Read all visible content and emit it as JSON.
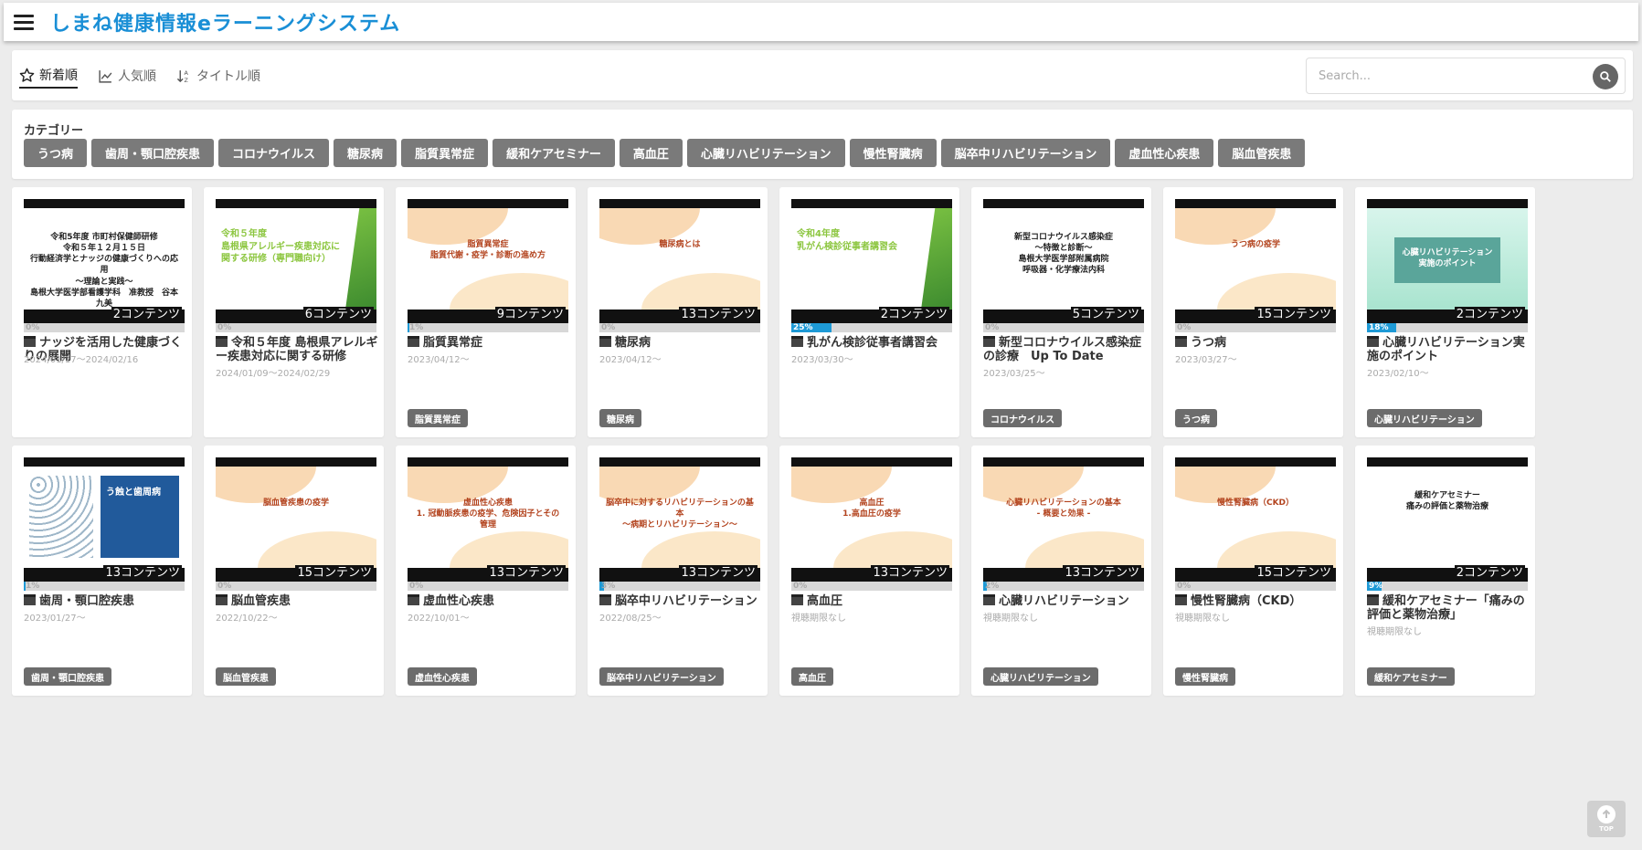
{
  "header": {
    "title": "しまね健康情報eラーニングシステム",
    "menu_icon": "hamburger-icon"
  },
  "sort": {
    "tabs": [
      {
        "label": "新着順",
        "icon": "star-icon",
        "active": true
      },
      {
        "label": "人気順",
        "icon": "trend-icon",
        "active": false
      },
      {
        "label": "タイトル順",
        "icon": "sort-az-icon",
        "active": false
      }
    ]
  },
  "search": {
    "placeholder": "Search...",
    "icon": "search-icon"
  },
  "categories": {
    "heading": "カテゴリー",
    "items": [
      "うつ病",
      "歯周・顎口腔疾患",
      "コロナウイルス",
      "糖尿病",
      "脂質異常症",
      "緩和ケアセミナー",
      "高血圧",
      "心臓リハビリテーション",
      "慢性腎臓病",
      "脳卒中リハビリテーション",
      "虚血性心疾患",
      "脳血管疾患"
    ]
  },
  "courses": [
    {
      "title": "ナッジを活用した健康づくりの展開",
      "date": "2024/01/17～2024/02/16",
      "count": "2コンテンツ",
      "progress": 0,
      "progress_label": "0%",
      "tag": "",
      "slide_style": "white",
      "slide_text": "令和5年度 市町村保健師研修\n令和５年１２月１５日\n行動経済学とナッジの健康づくりへの応用\n～理論と実践～\n島根大学医学部看護学科　准教授　谷本 九美"
    },
    {
      "title": "令和５年度 島根県アレルギー疾患対応に関する研修",
      "date": "2024/01/09～2024/02/29",
      "count": "6コンテンツ",
      "progress": 0,
      "progress_label": "0%",
      "tag": "",
      "slide_style": "green",
      "slide_text": "令和５年度\n島根県アレルギー疾患対応に\n関する研修（専門職向け）"
    },
    {
      "title": "脂質異常症",
      "date": "2023/04/12～",
      "count": "9コンテンツ",
      "progress": 1,
      "progress_label": "1%",
      "tag": "脂質異常症",
      "slide_style": "peach",
      "slide_text": "脂質異常症\n脂質代謝・疫学・診断の進め方"
    },
    {
      "title": "糖尿病",
      "date": "2023/04/12～",
      "count": "13コンテンツ",
      "progress": 0,
      "progress_label": "0%",
      "tag": "糖尿病",
      "slide_style": "peach",
      "slide_text": "糖尿病とは"
    },
    {
      "title": "乳がん検診従事者講習会",
      "date": "2023/03/30～",
      "count": "2コンテンツ",
      "progress": 25,
      "progress_label": "25%",
      "tag": "",
      "slide_style": "green",
      "slide_text": "令和4年度\n乳がん検診従事者講習会"
    },
    {
      "title": "新型コロナウイルス感染症の診療　Up To Date",
      "date": "2023/03/25～",
      "count": "5コンテンツ",
      "progress": 0,
      "progress_label": "0%",
      "tag": "コロナウイルス",
      "slide_style": "white",
      "slide_text": "新型コロナウイルス感染症\n～特徴と診断～\n島根大学医学部附属病院\n呼吸器・化学療法内科"
    },
    {
      "title": "うつ病",
      "date": "2023/03/27～",
      "count": "15コンテンツ",
      "progress": 0,
      "progress_label": "0%",
      "tag": "うつ病",
      "slide_style": "peach",
      "slide_text": "うつ病の疫学"
    },
    {
      "title": "心臓リハビリテーション実施のポイント",
      "date": "2023/02/10～",
      "count": "2コンテンツ",
      "progress": 18,
      "progress_label": "18%",
      "tag": "心臓リハビリテーション",
      "slide_style": "teal",
      "slide_text": "心臓リハビリテーション\n実施のポイント"
    },
    {
      "title": "歯周・顎口腔疾患",
      "date": "2023/01/27～",
      "count": "13コンテンツ",
      "progress": 1,
      "progress_label": "1%",
      "tag": "歯周・顎口腔疾患",
      "slide_style": "blue",
      "slide_text": "う蝕と歯周病"
    },
    {
      "title": "脳血管疾患",
      "date": "2022/10/22～",
      "count": "15コンテンツ",
      "progress": 0,
      "progress_label": "0%",
      "tag": "脳血管疾患",
      "slide_style": "peach",
      "slide_text": "脳血管疾患の疫学"
    },
    {
      "title": "虚血性心疾患",
      "date": "2022/10/01～",
      "count": "13コンテンツ",
      "progress": 0,
      "progress_label": "0%",
      "tag": "虚血性心疾患",
      "slide_style": "peach",
      "slide_text": "虚血性心疾患\n1. 冠動脈疾患の疫学、危険因子とその管理"
    },
    {
      "title": "脳卒中リハビリテーション",
      "date": "2022/08/25～",
      "count": "13コンテンツ",
      "progress": 3,
      "progress_label": "3%",
      "tag": "脳卒中リハビリテーション",
      "slide_style": "peach",
      "slide_text": "脳卒中に対するリハビリテーションの基本\n～病期とリハビリテーション～"
    },
    {
      "title": "高血圧",
      "date": "視聴期限なし",
      "count": "13コンテンツ",
      "progress": 0,
      "progress_label": "0%",
      "tag": "高血圧",
      "slide_style": "peach",
      "slide_text": "高血圧\n1.高血圧の疫学"
    },
    {
      "title": "心臓リハビリテーション",
      "date": "視聴期限なし",
      "count": "13コンテンツ",
      "progress": 2,
      "progress_label": "2%",
      "tag": "心臓リハビリテーション",
      "slide_style": "peach",
      "slide_text": "心臓リハビリテーションの基本\n- 概要と効果 -"
    },
    {
      "title": "慢性腎臓病（CKD）",
      "date": "視聴期限なし",
      "count": "15コンテンツ",
      "progress": 0,
      "progress_label": "0%",
      "tag": "慢性腎臓病",
      "slide_style": "peach",
      "slide_text": "慢性腎臓病（CKD）"
    },
    {
      "title": "緩和ケアセミナー「痛みの評価と薬物治療」",
      "date": "視聴期限なし",
      "count": "2コンテンツ",
      "progress": 9,
      "progress_label": "9%",
      "tag": "緩和ケアセミナー",
      "slide_style": "white",
      "slide_text": "緩和ケアセミナー\n痛みの評価と薬物治療"
    }
  ],
  "top_button": {
    "label": "TOP",
    "icon": "arrow-up-icon"
  },
  "colors": {
    "brand": "#1a8fd6",
    "progress": "#1e9ad6",
    "tag": "#6c6c6c",
    "category": "#7a7a7a"
  }
}
